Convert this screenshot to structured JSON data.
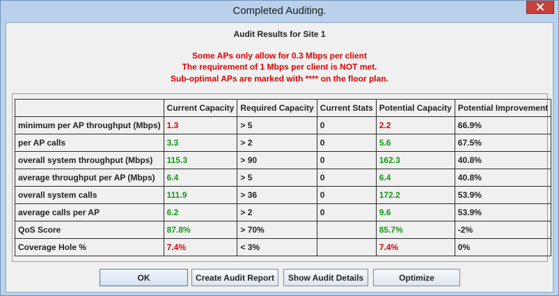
{
  "window": {
    "title": "Completed Auditing."
  },
  "heading": "Audit Results for Site 1",
  "warnings": [
    "Some APs only allow for 0.3 Mbps per client",
    "The requirement of 1 Mbps per client is NOT met.",
    "Sub-optimal APs are marked with **** on the floor plan."
  ],
  "table": {
    "headers": [
      "",
      "Current Capacity",
      "Required Capacity",
      "Current Stats",
      "Potential Capacity",
      "Potential Improvement"
    ],
    "rows": [
      {
        "metric": "minimum per AP throughput (Mbps)",
        "current": "1.3",
        "required": "> 5",
        "stats": "0",
        "potential": "2.2",
        "improvement": "66.9%"
      },
      {
        "metric": "per AP calls",
        "current": "3.3",
        "required": "> 2",
        "stats": "0",
        "potential": "5.6",
        "improvement": "67.5%"
      },
      {
        "metric": "overall system throughput (Mbps)",
        "current": "115.3",
        "required": "> 90",
        "stats": "0",
        "potential": "162.3",
        "improvement": "40.8%"
      },
      {
        "metric": "average throughput per AP (Mbps)",
        "current": "6.4",
        "required": "> 5",
        "stats": "0",
        "potential": "6.4",
        "improvement": "40.8%"
      },
      {
        "metric": "overall system calls",
        "current": "111.9",
        "required": "> 36",
        "stats": "0",
        "potential": "172.2",
        "improvement": "53.9%"
      },
      {
        "metric": "average calls per AP",
        "current": "6.2",
        "required": "> 2",
        "stats": "0",
        "potential": "9.6",
        "improvement": "53.9%"
      },
      {
        "metric": "QoS Score",
        "current": "87.8%",
        "required": "> 70%",
        "stats": "",
        "potential": "85.7%",
        "improvement": "-2%"
      },
      {
        "metric": "Coverage Hole %",
        "current": "7.4%",
        "required": "< 3%",
        "stats": "",
        "potential": "7.4%",
        "improvement": "0%"
      }
    ]
  },
  "buttons": {
    "ok": "OK",
    "create_report": "Create Audit Report",
    "show_details": "Show Audit Details",
    "optimize": "Optimize"
  },
  "colors": {
    "warning": "#e00000",
    "good": "#119a11",
    "bad": "#e00000",
    "close_button": "#c7403a"
  }
}
